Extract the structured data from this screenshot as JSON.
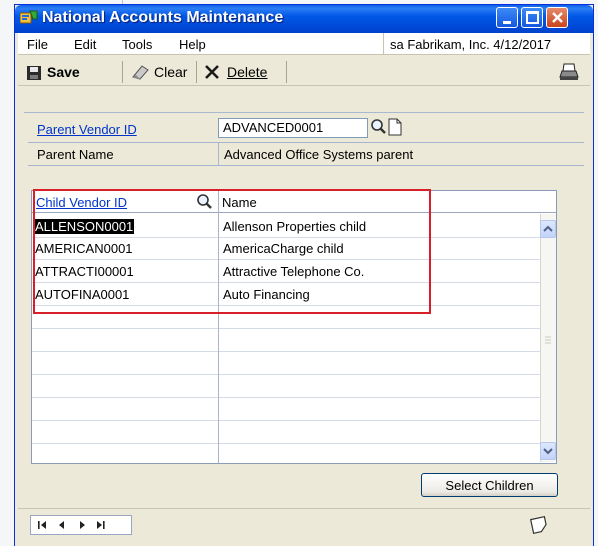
{
  "window": {
    "title": "National Accounts Maintenance"
  },
  "menu": {
    "items": [
      "File",
      "Edit",
      "Tools",
      "Help"
    ],
    "company_info": "sa  Fabrikam, Inc.  4/12/2017"
  },
  "toolbar": {
    "save_label": "Save",
    "clear_label": "Clear",
    "delete_label": "Delete"
  },
  "form": {
    "parent_vendor_label": "Parent Vendor ID",
    "parent_vendor_value": "ADVANCED0001",
    "parent_name_label": "Parent Name",
    "parent_name_value": "Advanced Office Systems parent"
  },
  "grid": {
    "col_vendor": "Child Vendor ID",
    "col_name": "Name",
    "rows": [
      {
        "id": "ALLENSON0001",
        "name": "Allenson Properties child",
        "selected": true
      },
      {
        "id": "AMERICAN0001",
        "name": "AmericaCharge child",
        "selected": false
      },
      {
        "id": "ATTRACTI00001",
        "name": "Attractive Telephone Co.",
        "selected": false
      },
      {
        "id": "AUTOFINA0001",
        "name": "Auto Financing",
        "selected": false
      }
    ]
  },
  "buttons": {
    "select_children": "Select Children"
  },
  "colors": {
    "title_bar": "#0058e6",
    "highlight_box": "#d7202a",
    "link": "#0033cc"
  }
}
